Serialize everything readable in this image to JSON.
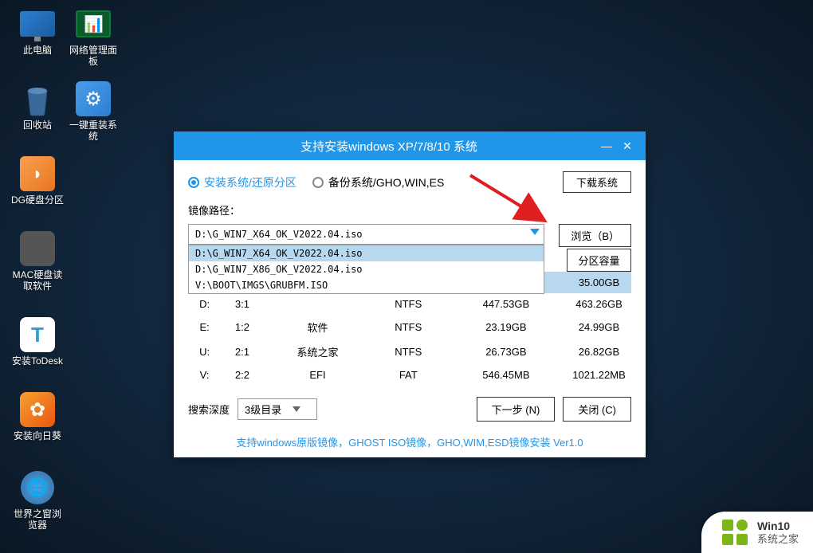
{
  "desktop": {
    "icons": [
      {
        "label": "此电脑"
      },
      {
        "label": "网络管理面板"
      },
      {
        "label": "回收站"
      },
      {
        "label": "一键重装系统"
      },
      {
        "label": "DG硬盘分区"
      },
      {
        "label": "MAC硬盘读取软件"
      },
      {
        "label": "安装ToDesk"
      },
      {
        "label": "安装向日葵"
      },
      {
        "label": "世界之窗浏览器"
      }
    ]
  },
  "dialog": {
    "title": "支持安装windows XP/7/8/10 系统",
    "radio1": "安装系统/还原分区",
    "radio2": "备份系统/GHO,WIN,ES",
    "download_btn": "下载系统",
    "path_label": "镜像路径：",
    "path_value": "D:\\G_WIN7_X64_OK_V2022.04.iso",
    "browse_btn": "浏览（B）",
    "dropdown_items": [
      "D:\\G_WIN7_X64_OK_V2022.04.iso",
      "D:\\G_WIN7_X86_OK_V2022.04.iso",
      "V:\\BOOT\\IMGS\\GRUBFM.ISO"
    ],
    "table": {
      "header_visible": "分区容量",
      "rows": [
        {
          "drive": "",
          "idx": "",
          "name": "",
          "fs": "",
          "used": "",
          "cap": "35.00GB",
          "hl": true
        },
        {
          "drive": "D:",
          "idx": "3:1",
          "name": "",
          "fs": "NTFS",
          "used": "447.53GB",
          "cap": "463.26GB"
        },
        {
          "drive": "E:",
          "idx": "1:2",
          "name": "软件",
          "fs": "NTFS",
          "used": "23.19GB",
          "cap": "24.99GB"
        },
        {
          "drive": "U:",
          "idx": "2:1",
          "name": "系统之家",
          "fs": "NTFS",
          "used": "26.73GB",
          "cap": "26.82GB"
        },
        {
          "drive": "V:",
          "idx": "2:2",
          "name": "EFI",
          "fs": "FAT",
          "used": "546.45MB",
          "cap": "1021.22MB"
        }
      ]
    },
    "search_label": "搜索深度",
    "search_value": "3级目录",
    "next_btn": "下一步 (N)",
    "close_btn": "关闭 (C)",
    "footer": "支持windows原版镜像，GHOST ISO镜像，GHO,WIM,ESD镜像安装 Ver1.0"
  },
  "watermark": {
    "line1": "Win10",
    "line2": "系统之家"
  }
}
